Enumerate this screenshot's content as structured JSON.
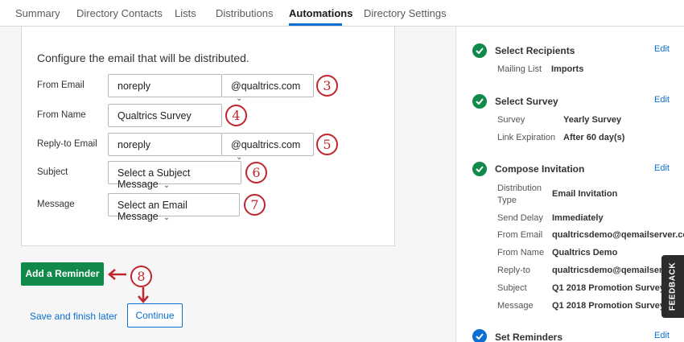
{
  "tabs": [
    {
      "label": "Summary"
    },
    {
      "label": "Directory Contacts"
    },
    {
      "label": "Lists"
    },
    {
      "label": "Distributions"
    },
    {
      "label": "Automations",
      "active": true
    },
    {
      "label": "Directory Settings"
    }
  ],
  "form": {
    "title": "Configure the email that will be distributed.",
    "from_email": {
      "label": "From Email",
      "value": "noreply",
      "domain": "@qualtrics.com"
    },
    "from_name": {
      "label": "From Name",
      "value": "Qualtrics Survey"
    },
    "reply_to": {
      "label": "Reply-to Email",
      "value": "noreply",
      "domain": "@qualtrics.com"
    },
    "subject": {
      "label": "Subject",
      "value": "Select a Subject Message"
    },
    "message": {
      "label": "Message",
      "value": "Select an Email Message"
    }
  },
  "callouts": [
    "3",
    "4",
    "5",
    "6",
    "7",
    "8"
  ],
  "actions": {
    "add_reminder": "Add a Reminder",
    "save_later": "Save and finish later",
    "continue": "Continue"
  },
  "summary": {
    "edit_label": "Edit",
    "select_recipients": {
      "title": "Select Recipients",
      "rows": [
        {
          "label": "Mailing List",
          "value": "Imports"
        }
      ]
    },
    "select_survey": {
      "title": "Select Survey",
      "rows": [
        {
          "label": "Survey",
          "value": "Yearly Survey"
        },
        {
          "label": "Link Expiration",
          "value": "After 60 day(s)"
        }
      ]
    },
    "compose_invitation": {
      "title": "Compose Invitation",
      "rows": [
        {
          "label": "Distribution Type",
          "value": "Email Invitation"
        },
        {
          "label": "Send Delay",
          "value": "Immediately"
        },
        {
          "label": "From Email",
          "value": "qualtricsdemo@qemailserver.com"
        },
        {
          "label": "From Name",
          "value": "Qualtrics Demo"
        },
        {
          "label": "Reply-to",
          "value": "qualtricsdemo@qemailserver.com"
        },
        {
          "label": "Subject",
          "value": "Q1 2018 Promotion Survey"
        },
        {
          "label": "Message",
          "value": "Q1 2018 Promotion Survey"
        }
      ]
    },
    "set_reminders": {
      "title": "Set Reminders"
    }
  },
  "feedback": "FEEDBACK",
  "colors": {
    "accent_blue": "#0b6ed0",
    "success_green": "#10894a",
    "callout_red": "#c0242d"
  }
}
